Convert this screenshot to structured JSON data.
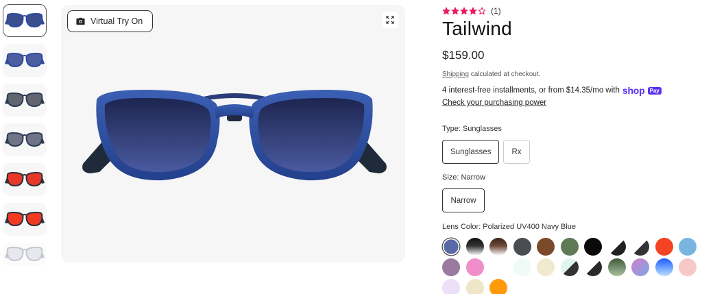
{
  "gallery": {
    "try_on_label": "Virtual Try On",
    "thumbnails": [
      {
        "name": "thumb-front-navy",
        "lens": "#3b4f8f",
        "frame": "#2f4a9c"
      },
      {
        "name": "thumb-angle-navy",
        "lens": "#4d5ea0",
        "frame": "#2f4a9c"
      },
      {
        "name": "thumb-gray",
        "lens": "#606570",
        "frame": "#2f3a55"
      },
      {
        "name": "thumb-gradient",
        "lens": "#6f7486",
        "frame": "#2f3a55"
      },
      {
        "name": "thumb-red-front",
        "lens": "#e8382a",
        "frame": "#2a2f3a"
      },
      {
        "name": "thumb-red-angle",
        "lens": "#f13a22",
        "frame": "#2a2f3a"
      },
      {
        "name": "thumb-clear",
        "lens": "#c8ced8",
        "frame": "#7d8597"
      }
    ]
  },
  "product": {
    "rating_value": 4,
    "rating_max": 5,
    "review_count": "(1)",
    "star_color": "#e91e63",
    "title": "Tailwind",
    "price": "$159.00",
    "shipping_link": "Shipping",
    "shipping_rest": " calculated at checkout.",
    "installments_text": "4 interest-free installments, or from $14.35/mo with",
    "shop_word": "shop",
    "pay_badge": "Pay",
    "check_power": "Check your purchasing power",
    "shop_pay_color": "#5a31f4"
  },
  "options": {
    "type_label": "Type: Sunglasses",
    "type_values": [
      "Sunglasses",
      "Rx"
    ],
    "size_label": "Size: Narrow",
    "size_values": [
      "Narrow"
    ],
    "lens_label": "Lens Color: Polarized UV400 Navy Blue",
    "lens_swatches": [
      {
        "name": "navy-blue",
        "bg": "#5a6aa8",
        "selected": true
      },
      {
        "name": "black-gradient",
        "bg": "linear-gradient(180deg,#111 0%,#333 45%,#fff 100%)"
      },
      {
        "name": "brown-gradient",
        "bg": "linear-gradient(180deg,#3a2418 0%,#6b4a3a 45%,#fff 100%)"
      },
      {
        "name": "gray",
        "bg": "#4a4d52"
      },
      {
        "name": "brown",
        "bg": "#7a4a2a"
      },
      {
        "name": "green",
        "bg": "#5f7a55"
      },
      {
        "name": "black",
        "bg": "#0a0a0a"
      },
      {
        "name": "black-white-split",
        "bg": "linear-gradient(135deg,#fff 50%,#222 50%)"
      },
      {
        "name": "black-white-split-2",
        "bg": "linear-gradient(135deg,#fff 50%,#333 50%)"
      },
      {
        "name": "red",
        "bg": "#f44322"
      },
      {
        "name": "sky-blue",
        "bg": "#7ab4e0"
      },
      {
        "name": "purple",
        "bg": "#9a7aa0"
      },
      {
        "name": "pink",
        "bg": "#ef8ec8"
      },
      {
        "name": "clear",
        "bg": "#ffffff"
      },
      {
        "name": "mint-clear",
        "bg": "#f0fbf8"
      },
      {
        "name": "cream",
        "bg": "#f1ead0"
      },
      {
        "name": "mint-black-split",
        "bg": "linear-gradient(135deg,#dff5ef 50%,#333 50%)"
      },
      {
        "name": "white-black-split",
        "bg": "linear-gradient(135deg,#fff 50%,#2a2a2a 50%)"
      },
      {
        "name": "olive-gradient",
        "bg": "linear-gradient(180deg,#3f5a3a 0%,#a8c0a0 100%)"
      },
      {
        "name": "violet-gradient",
        "bg": "linear-gradient(135deg,#d37ec7 0%,#7ea7e8 100%)"
      },
      {
        "name": "blue-gradient",
        "bg": "linear-gradient(180deg,#1a5cff 0%,#bfe0ff 100%)"
      },
      {
        "name": "blush",
        "bg": "#f6c9c7"
      },
      {
        "name": "lavender",
        "bg": "#ecdff8"
      },
      {
        "name": "ivory",
        "bg": "#efe6c8"
      },
      {
        "name": "orange",
        "bg": "#ff9a0a"
      }
    ]
  }
}
